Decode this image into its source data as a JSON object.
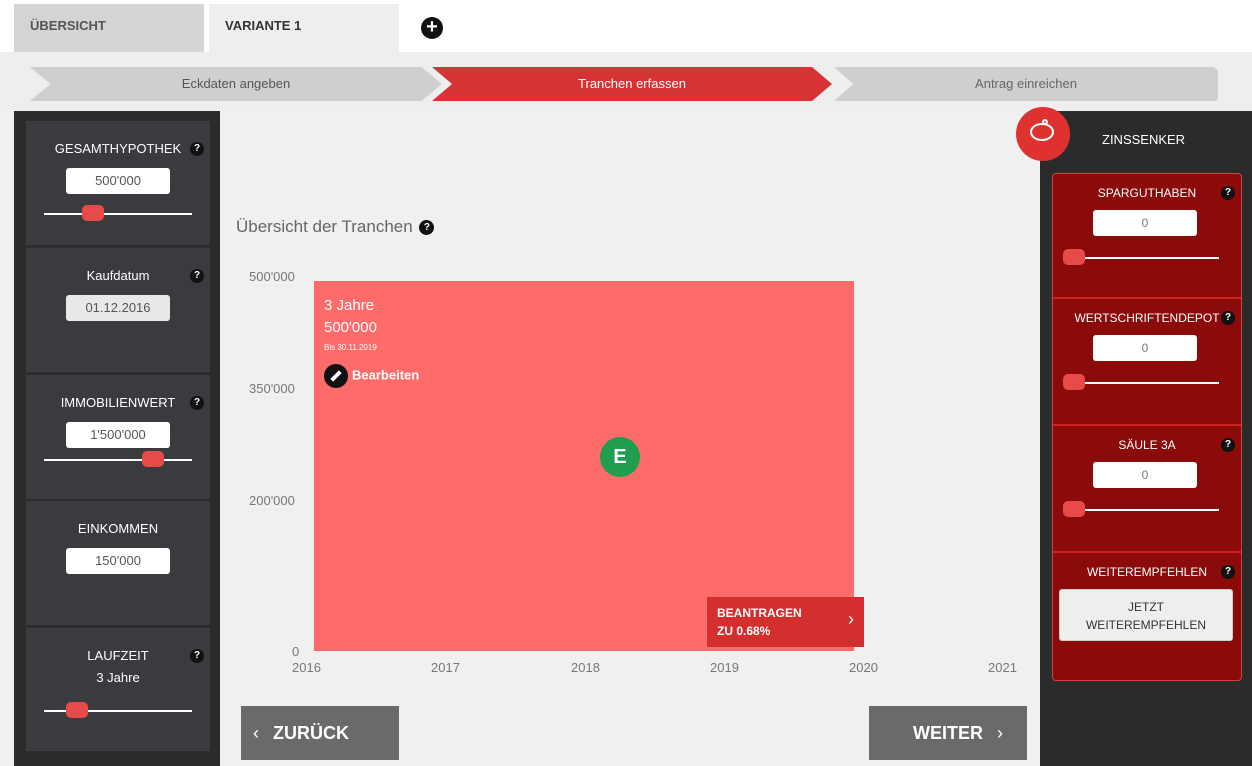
{
  "tabs": [
    {
      "label": "ÜBERSICHT"
    },
    {
      "label": "VARIANTE 1"
    }
  ],
  "add_tab_icon": "plus-circle-icon",
  "steps": [
    {
      "label": "Eckdaten angeben",
      "state": "done"
    },
    {
      "label": "Tranchen erfassen",
      "state": "active"
    },
    {
      "label": "Antrag einreichen",
      "state": "pending"
    }
  ],
  "left": {
    "gesamthypothek": {
      "label": "GESAMTHYPOTHEK",
      "value": "500'000"
    },
    "kaufdatum": {
      "label": "Kaufdatum",
      "value": "01.12.2016"
    },
    "immobilienwert": {
      "label": "IMMOBILIENWERT",
      "value": "1'500'000"
    },
    "einkommen": {
      "label": "EINKOMMEN",
      "value": "150'000"
    },
    "laufzeit": {
      "label": "LAUFZEIT",
      "value": "3 Jahre"
    }
  },
  "help_glyph": "?",
  "center": {
    "title": "Übersicht der Tranchen",
    "y_ticks": [
      "500'000",
      "350'000",
      "200'000",
      "0"
    ],
    "x_ticks": [
      "2016",
      "2017",
      "2018",
      "2019",
      "2020",
      "2021"
    ],
    "tranche": {
      "term": "3 Jahre",
      "amount": "500'000",
      "until": "Bis 30.11.2019",
      "edit_label": "Bearbeiten",
      "badge": "E",
      "apply_line1": "BEANTRAGEN",
      "apply_line2": "ZU 0.68%"
    },
    "back_label": "ZURÜCK",
    "next_label": "WEITER"
  },
  "right": {
    "title": "ZINSSENKER",
    "sparguthaben": {
      "label": "SPARGUTHABEN",
      "value": "0"
    },
    "wertschriftendepot": {
      "label": "WERTSCHRIFTENDEPOT",
      "value": "0"
    },
    "saeule3a": {
      "label": "SÄULE 3A",
      "value": "0"
    },
    "weiterempfehlen": {
      "label": "WEITEREMPFEHLEN",
      "button_line1": "JETZT",
      "button_line2": "WEITEREMPFEHLEN"
    }
  },
  "colors": {
    "accent": "#d63434",
    "panel": "#2b2b2b",
    "card": "#3a3b3f",
    "tranche": "#fe6b6b",
    "zins": "#8b0a0a",
    "badge": "#1e9e4e"
  }
}
